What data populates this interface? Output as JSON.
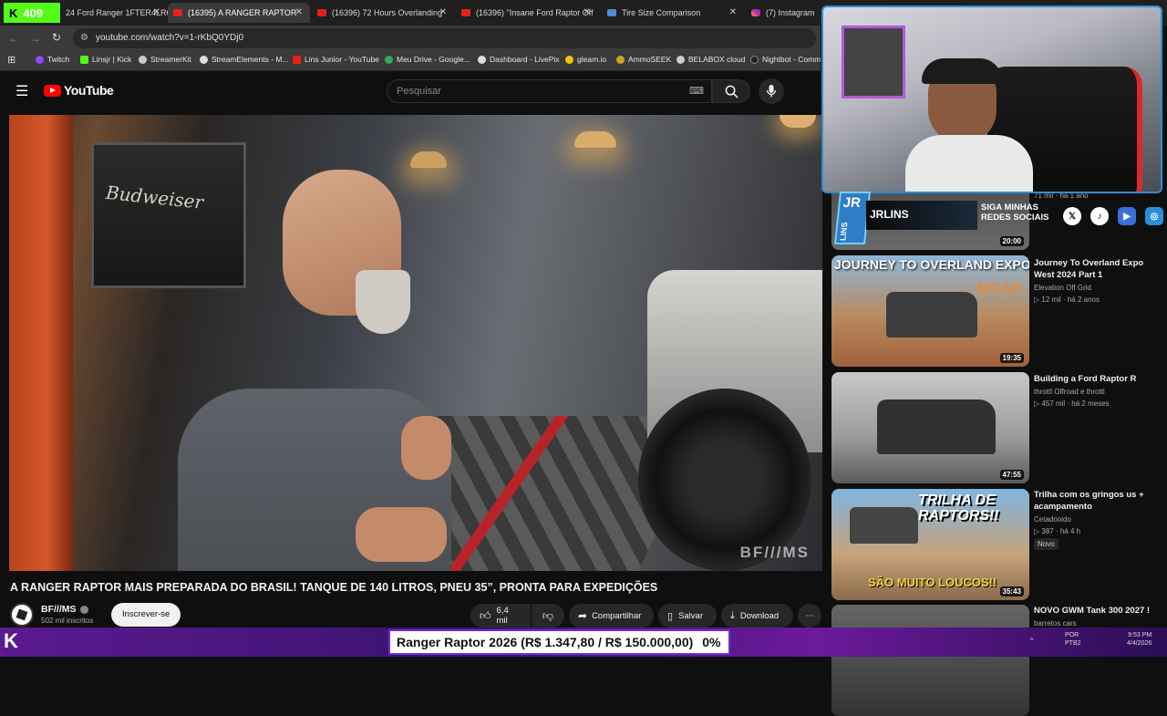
{
  "tabs": [
    {
      "label": "409",
      "badge": "K"
    },
    {
      "label": "24 Ford Ranger 1FTER4LR6R"
    },
    {
      "label": "(16395) A RANGER RAPTOR"
    },
    {
      "label": "(16396) 72 Hours Overlanding"
    },
    {
      "label": "(16396) \"Insane Ford Raptor Off"
    },
    {
      "label": "Tire Size Comparison"
    },
    {
      "label": "(7) Instagram"
    }
  ],
  "address": {
    "url": "youtube.com/watch?v=1-rKbQ0YDj0"
  },
  "bookmarks": [
    "Twitch",
    "Linsjr | Kick",
    "StreamerKit",
    "StreamElements - M...",
    "Lins Junior - YouTube",
    "Meu Drive - Google...",
    "Dashboard - LivePix",
    "gleam.io",
    "AmmoSEEK",
    "BELABOX cloud",
    "Nightbot - Comm"
  ],
  "youtube": {
    "logo": "YouTube",
    "search_placeholder": "Pesquisar"
  },
  "video": {
    "watermark": "BF///MS",
    "title": "A RANGER RAPTOR MAIS PREPARADA DO BRASIL! TANQUE DE 140 LITROS, PNEU 35”, PRONTA PARA EXPEDIÇÕES",
    "channel": "BF///MS",
    "subscribers": "502 mil inscritos",
    "subscribe_label": "Inscrever-se",
    "likes": "6,4 mil",
    "share_label": "Compartilhar",
    "save_label": "Salvar",
    "download_label": "Download",
    "more_icon": "⋯"
  },
  "overlay": {
    "brand_top": "JR",
    "brand_bottom": "LINS",
    "name": "JRLINS",
    "social_line1": "SIGA MINHAS",
    "social_line2": "REDES SOCIAIS",
    "ticker": "Ranger Raptor 2026 (R$ 1.347,80 / R$ 150.000,00)",
    "ticker_pct": "0%"
  },
  "sidebar": {
    "partial_meta": "71 mil · há 1 ano",
    "partial_duration": "20:00",
    "items": [
      {
        "title": "Journey To Overland Expo West 2024 Part 1",
        "channel": "Elevation Off Grid",
        "views": "12 mil",
        "age": "há 2 anos",
        "duration": "19:35",
        "thumb_text": "JOURNEY TO OVERLAND EXPO WEST",
        "thumb_sub": "MOAB"
      },
      {
        "title": "Building a Ford Raptor R",
        "channel": "throttl Offroad e throttl",
        "views": "457 mil",
        "age": "há 2 meses",
        "duration": "47:55",
        "thumb_text": "",
        "thumb_sub": ""
      },
      {
        "title": "Trilha com os gringos us + acampamento",
        "channel": "Cetadooido",
        "views": "387",
        "age": "há 4 h",
        "badge": "Novo",
        "duration": "35:43",
        "thumb_text": "TRILHA DE RAPTORS!!",
        "thumb_sub": "SÃO MUITO LOUCOS!!"
      },
      {
        "title": "NOVO GWM Tank 300 2027 !",
        "channel": "barretos cars",
        "views": "",
        "age": "",
        "duration": "",
        "thumb_text": "",
        "thumb_sub": ""
      }
    ]
  },
  "taskbar": {
    "lang1": "POR",
    "lang2": "PTB2",
    "time": "9:53 PM",
    "date": "4/4/2026"
  }
}
